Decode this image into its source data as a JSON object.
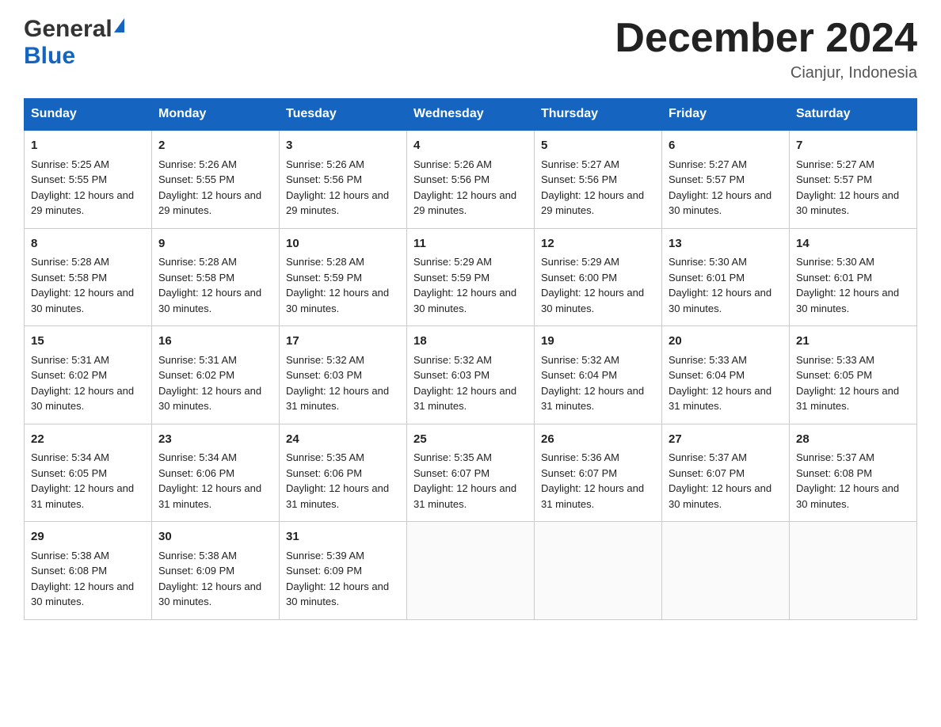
{
  "header": {
    "logo_general": "General",
    "logo_blue": "Blue",
    "month_title": "December 2024",
    "location": "Cianjur, Indonesia"
  },
  "days_of_week": [
    "Sunday",
    "Monday",
    "Tuesday",
    "Wednesday",
    "Thursday",
    "Friday",
    "Saturday"
  ],
  "weeks": [
    [
      {
        "day": "1",
        "sunrise": "5:25 AM",
        "sunset": "5:55 PM",
        "daylight": "12 hours and 29 minutes."
      },
      {
        "day": "2",
        "sunrise": "5:26 AM",
        "sunset": "5:55 PM",
        "daylight": "12 hours and 29 minutes."
      },
      {
        "day": "3",
        "sunrise": "5:26 AM",
        "sunset": "5:56 PM",
        "daylight": "12 hours and 29 minutes."
      },
      {
        "day": "4",
        "sunrise": "5:26 AM",
        "sunset": "5:56 PM",
        "daylight": "12 hours and 29 minutes."
      },
      {
        "day": "5",
        "sunrise": "5:27 AM",
        "sunset": "5:56 PM",
        "daylight": "12 hours and 29 minutes."
      },
      {
        "day": "6",
        "sunrise": "5:27 AM",
        "sunset": "5:57 PM",
        "daylight": "12 hours and 30 minutes."
      },
      {
        "day": "7",
        "sunrise": "5:27 AM",
        "sunset": "5:57 PM",
        "daylight": "12 hours and 30 minutes."
      }
    ],
    [
      {
        "day": "8",
        "sunrise": "5:28 AM",
        "sunset": "5:58 PM",
        "daylight": "12 hours and 30 minutes."
      },
      {
        "day": "9",
        "sunrise": "5:28 AM",
        "sunset": "5:58 PM",
        "daylight": "12 hours and 30 minutes."
      },
      {
        "day": "10",
        "sunrise": "5:28 AM",
        "sunset": "5:59 PM",
        "daylight": "12 hours and 30 minutes."
      },
      {
        "day": "11",
        "sunrise": "5:29 AM",
        "sunset": "5:59 PM",
        "daylight": "12 hours and 30 minutes."
      },
      {
        "day": "12",
        "sunrise": "5:29 AM",
        "sunset": "6:00 PM",
        "daylight": "12 hours and 30 minutes."
      },
      {
        "day": "13",
        "sunrise": "5:30 AM",
        "sunset": "6:01 PM",
        "daylight": "12 hours and 30 minutes."
      },
      {
        "day": "14",
        "sunrise": "5:30 AM",
        "sunset": "6:01 PM",
        "daylight": "12 hours and 30 minutes."
      }
    ],
    [
      {
        "day": "15",
        "sunrise": "5:31 AM",
        "sunset": "6:02 PM",
        "daylight": "12 hours and 30 minutes."
      },
      {
        "day": "16",
        "sunrise": "5:31 AM",
        "sunset": "6:02 PM",
        "daylight": "12 hours and 30 minutes."
      },
      {
        "day": "17",
        "sunrise": "5:32 AM",
        "sunset": "6:03 PM",
        "daylight": "12 hours and 31 minutes."
      },
      {
        "day": "18",
        "sunrise": "5:32 AM",
        "sunset": "6:03 PM",
        "daylight": "12 hours and 31 minutes."
      },
      {
        "day": "19",
        "sunrise": "5:32 AM",
        "sunset": "6:04 PM",
        "daylight": "12 hours and 31 minutes."
      },
      {
        "day": "20",
        "sunrise": "5:33 AM",
        "sunset": "6:04 PM",
        "daylight": "12 hours and 31 minutes."
      },
      {
        "day": "21",
        "sunrise": "5:33 AM",
        "sunset": "6:05 PM",
        "daylight": "12 hours and 31 minutes."
      }
    ],
    [
      {
        "day": "22",
        "sunrise": "5:34 AM",
        "sunset": "6:05 PM",
        "daylight": "12 hours and 31 minutes."
      },
      {
        "day": "23",
        "sunrise": "5:34 AM",
        "sunset": "6:06 PM",
        "daylight": "12 hours and 31 minutes."
      },
      {
        "day": "24",
        "sunrise": "5:35 AM",
        "sunset": "6:06 PM",
        "daylight": "12 hours and 31 minutes."
      },
      {
        "day": "25",
        "sunrise": "5:35 AM",
        "sunset": "6:07 PM",
        "daylight": "12 hours and 31 minutes."
      },
      {
        "day": "26",
        "sunrise": "5:36 AM",
        "sunset": "6:07 PM",
        "daylight": "12 hours and 31 minutes."
      },
      {
        "day": "27",
        "sunrise": "5:37 AM",
        "sunset": "6:07 PM",
        "daylight": "12 hours and 30 minutes."
      },
      {
        "day": "28",
        "sunrise": "5:37 AM",
        "sunset": "6:08 PM",
        "daylight": "12 hours and 30 minutes."
      }
    ],
    [
      {
        "day": "29",
        "sunrise": "5:38 AM",
        "sunset": "6:08 PM",
        "daylight": "12 hours and 30 minutes."
      },
      {
        "day": "30",
        "sunrise": "5:38 AM",
        "sunset": "6:09 PM",
        "daylight": "12 hours and 30 minutes."
      },
      {
        "day": "31",
        "sunrise": "5:39 AM",
        "sunset": "6:09 PM",
        "daylight": "12 hours and 30 minutes."
      },
      null,
      null,
      null,
      null
    ]
  ]
}
